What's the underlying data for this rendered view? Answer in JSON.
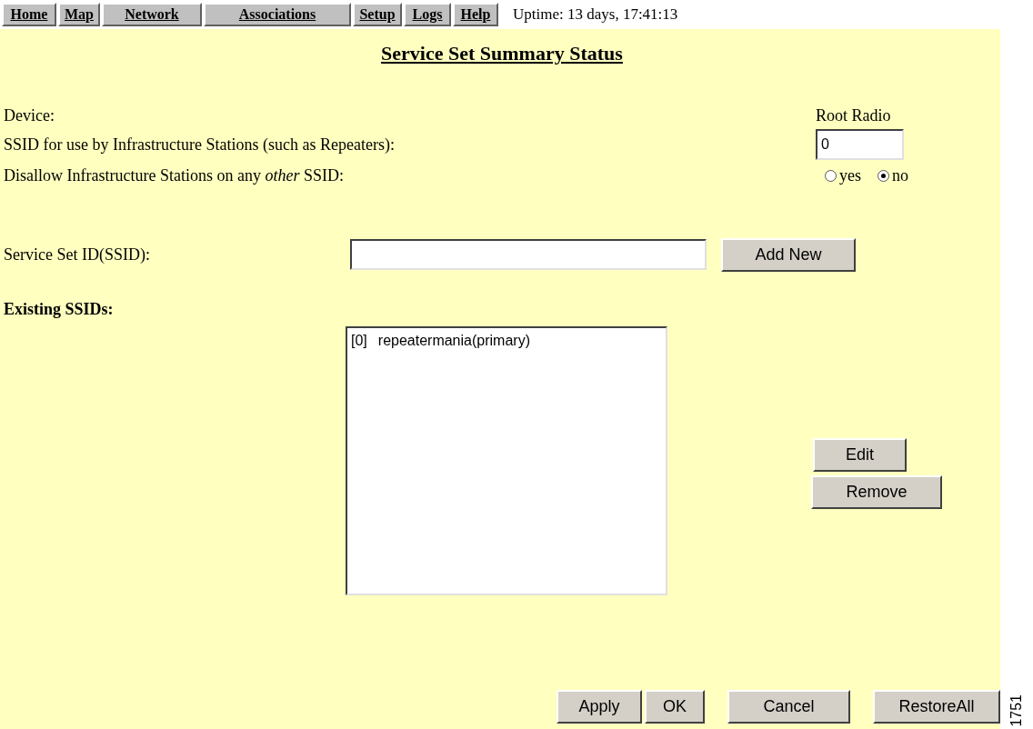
{
  "nav": {
    "tabs": [
      {
        "label": "Home"
      },
      {
        "label": "Map"
      },
      {
        "label": "Network"
      },
      {
        "label": "Associations"
      },
      {
        "label": "Setup"
      },
      {
        "label": "Logs"
      },
      {
        "label": "Help"
      }
    ],
    "uptime": "Uptime: 13 days, 17:41:13"
  },
  "title": "Service Set Summary Status",
  "device": {
    "label": "Device:",
    "column": "Root Radio"
  },
  "infra_ssid": {
    "label": "SSID for use by Infrastructure Stations (such as Repeaters):",
    "value": "0"
  },
  "disallow": {
    "label": "Disallow Infrastructure Stations on any *other* SSID:",
    "options": [
      {
        "label": "yes",
        "selected": false
      },
      {
        "label": "no",
        "selected": true
      }
    ]
  },
  "ssid_entry": {
    "label": "Service Set ID(SSID):",
    "button": "Add New"
  },
  "existing": {
    "label": "Existing SSIDs:",
    "items": [
      {
        "index": "[0]",
        "name": "repeatermania(primary)",
        "selected": false
      }
    ]
  },
  "side_buttons": [
    "Edit",
    "Remove"
  ],
  "footer_buttons": [
    "Apply",
    "OK",
    "Cancel",
    "RestoreAll"
  ],
  "figure_id": "1751"
}
